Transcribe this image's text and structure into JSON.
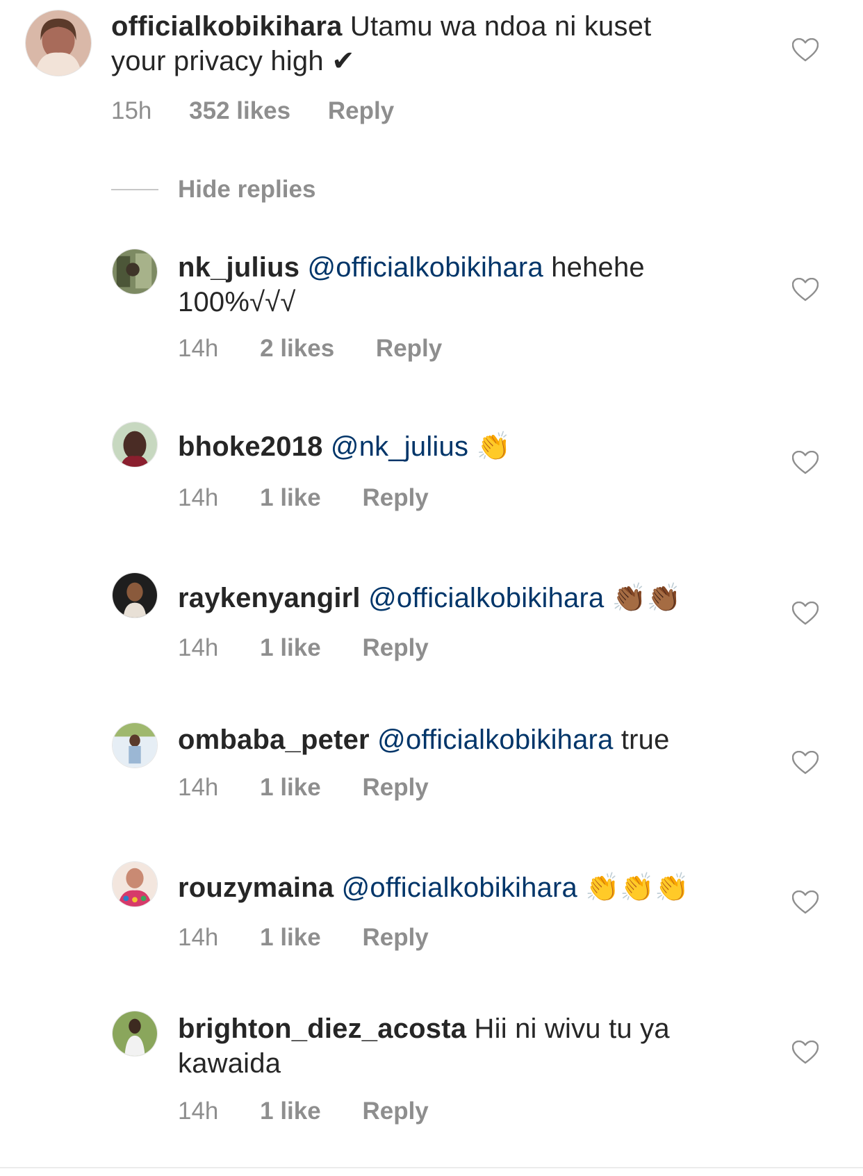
{
  "thread": {
    "hide_replies_label": "Hide replies",
    "comments": [
      {
        "username": "officialkobikihara",
        "mention": "",
        "text": " Utamu wa ndoa ni kuset your privacy high ✔",
        "time": "15h",
        "likes": "352 likes",
        "reply": "Reply",
        "avatar_color": "#a86b5a"
      },
      {
        "username": "nk_julius",
        "mention": " @officialkobikihara",
        "text": " hehehe 100%√√√",
        "time": "14h",
        "likes": "2 likes",
        "reply": "Reply",
        "avatar_color": "#5e6a4c"
      },
      {
        "username": "bhoke2018",
        "mention": " @nk_julius",
        "text": " 👏",
        "time": "14h",
        "likes": "1 like",
        "reply": "Reply",
        "avatar_color": "#4a2c25"
      },
      {
        "username": "raykenyangirl",
        "mention": " @officialkobikihara",
        "text": " 👏🏾👏🏾",
        "time": "14h",
        "likes": "1 like",
        "reply": "Reply",
        "avatar_color": "#2b2b2b"
      },
      {
        "username": "ombaba_peter",
        "mention": " @officialkobikihara",
        "text": " true",
        "time": "14h",
        "likes": "1 like",
        "reply": "Reply",
        "avatar_color": "#9bb7d4"
      },
      {
        "username": "rouzymaina",
        "mention": " @officialkobikihara",
        "text": " 👏👏👏",
        "time": "14h",
        "likes": "1 like",
        "reply": "Reply",
        "avatar_color": "#c98a73"
      },
      {
        "username": "brighton_diez_acosta",
        "mention": "",
        "text": " Hii ni wivu tu ya kawaida",
        "time": "14h",
        "likes": "1 like",
        "reply": "Reply",
        "avatar_color": "#6f8a4a"
      }
    ]
  },
  "colors": {
    "text": "#262626",
    "mention": "#003569",
    "meta": "#8e8e8e",
    "heart": "#8e8e8e"
  },
  "icons": {
    "like": "heart-outline-icon"
  }
}
